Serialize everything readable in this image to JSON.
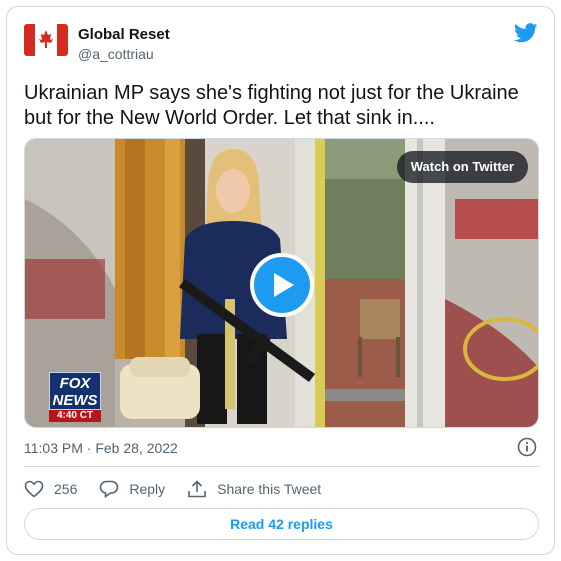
{
  "author": {
    "display_name": "Global Reset",
    "handle": "@a_cottriau"
  },
  "tweet": {
    "text": "Ukrainian MP says she's fighting not just for the Ukraine but for the New World Order. Let that sink in....",
    "timestamp": "11:03 PM · Feb 28, 2022"
  },
  "media": {
    "watch_label": "Watch on Twitter",
    "fox_line1": "FOX",
    "fox_line2": "NEWS",
    "fox_time": "4:40 CT"
  },
  "actions": {
    "like_count": "256",
    "reply_label": "Reply",
    "share_label": "Share this Tweet"
  },
  "read_replies_label": "Read 42 replies",
  "icons": {
    "avatar": "canada-flag-avatar",
    "brand": "twitter-bird-icon",
    "info": "info-icon",
    "like": "heart-icon",
    "reply": "reply-bubble-icon",
    "share": "share-icon",
    "play": "play-icon"
  },
  "colors": {
    "accent": "#1d9bf0",
    "text_primary": "#0f1419",
    "text_secondary": "#536471",
    "border": "#cfd9de"
  }
}
